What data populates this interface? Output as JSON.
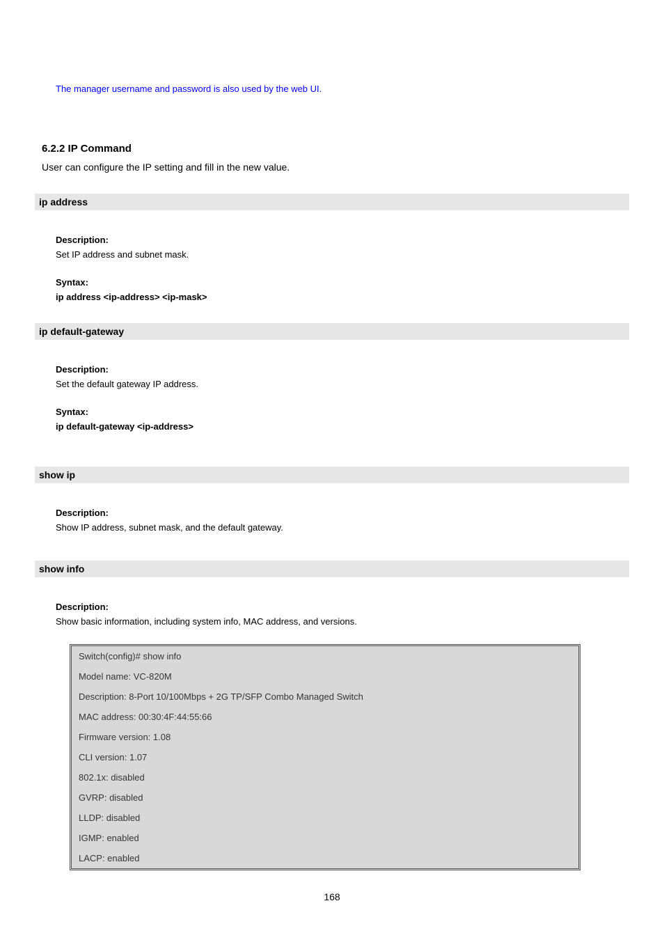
{
  "note_text": "The manager username and password is also used by the web UI.",
  "ip_section": {
    "heading": "6.2.2 IP Command",
    "intro": "User can configure the IP setting and fill in the new value."
  },
  "cmd_ip_address": {
    "title": "ip address",
    "desc_label": "Description:",
    "desc": "Set IP address and subnet mask.",
    "syntax_label": "Syntax:",
    "syntax": "ip address <ip-address> <ip-mask>"
  },
  "cmd_ip_gateway": {
    "title": "ip default-gateway",
    "desc_label": "Description:",
    "desc": "Set the default gateway IP address.",
    "syntax_label": "Syntax:",
    "syntax": "ip default-gateway <ip-address>"
  },
  "cmd_show_ip": {
    "title": "show ip",
    "desc_label": "Description:",
    "desc": "Show IP address, subnet mask, and the default gateway."
  },
  "cmd_show_info": {
    "title": "show info",
    "desc_label": "Description:",
    "desc": "Show basic information, including system info, MAC address, and versions."
  },
  "terminal": {
    "lines": [
      "Switch(config)# show info",
      "Model name: VC-820M",
      "Description: 8-Port 10/100Mbps + 2G TP/SFP    Combo Managed Switch",
      "MAC address: 00:30:4F:44:55:66",
      "Firmware version: 1.08",
      "CLI version: 1.07",
      "802.1x: disabled",
      "GVRP: disabled",
      "LLDP: disabled",
      "IGMP: enabled",
      "LACP: enabled"
    ]
  },
  "page_number": "168"
}
